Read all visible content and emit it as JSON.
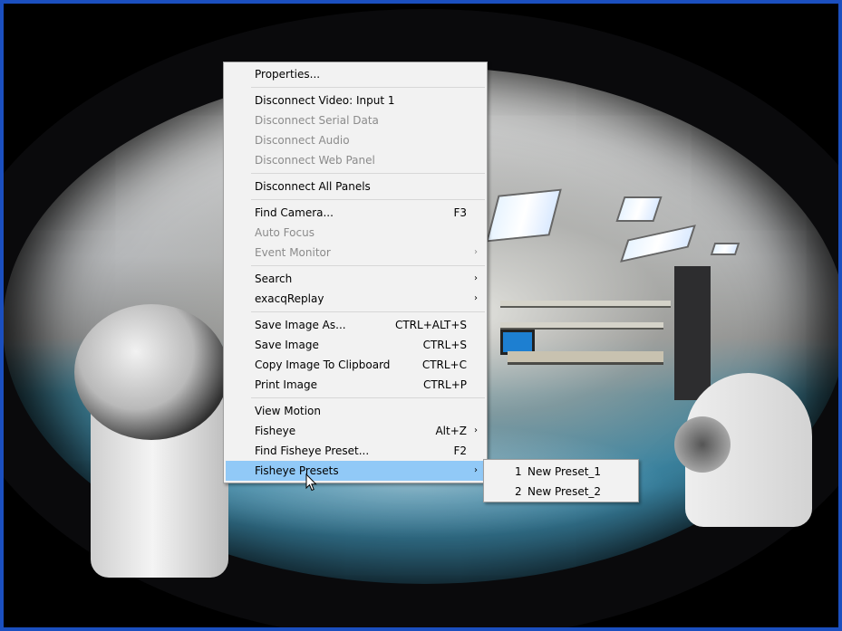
{
  "context_menu": {
    "items": [
      {
        "label": "Properties...",
        "shortcut": "",
        "arrow": "",
        "disabled": false
      },
      {
        "label": "Disconnect Video: Input 1",
        "shortcut": "",
        "arrow": "",
        "disabled": false
      },
      {
        "label": "Disconnect Serial Data",
        "shortcut": "",
        "arrow": "",
        "disabled": true
      },
      {
        "label": "Disconnect Audio",
        "shortcut": "",
        "arrow": "",
        "disabled": true
      },
      {
        "label": "Disconnect Web Panel",
        "shortcut": "",
        "arrow": "",
        "disabled": true
      },
      {
        "label": "Disconnect All Panels",
        "shortcut": "",
        "arrow": "",
        "disabled": false
      },
      {
        "label": "Find Camera...",
        "shortcut": "F3",
        "arrow": "",
        "disabled": false
      },
      {
        "label": "Auto Focus",
        "shortcut": "",
        "arrow": "",
        "disabled": true
      },
      {
        "label": "Event Monitor",
        "shortcut": "",
        "arrow": "›",
        "disabled": true
      },
      {
        "label": "Search",
        "shortcut": "",
        "arrow": "›",
        "disabled": false
      },
      {
        "label": "exacqReplay",
        "shortcut": "",
        "arrow": "›",
        "disabled": false
      },
      {
        "label": "Save Image As...",
        "shortcut": "CTRL+ALT+S",
        "arrow": "",
        "disabled": false
      },
      {
        "label": "Save Image",
        "shortcut": "CTRL+S",
        "arrow": "",
        "disabled": false
      },
      {
        "label": "Copy Image To Clipboard",
        "shortcut": "CTRL+C",
        "arrow": "",
        "disabled": false
      },
      {
        "label": "Print Image",
        "shortcut": "CTRL+P",
        "arrow": "",
        "disabled": false
      },
      {
        "label": "View Motion",
        "shortcut": "",
        "arrow": "",
        "disabled": false
      },
      {
        "label": "Fisheye",
        "shortcut": "Alt+Z",
        "arrow": "›",
        "disabled": false
      },
      {
        "label": "Find Fisheye Preset...",
        "shortcut": "F2",
        "arrow": "",
        "disabled": false
      },
      {
        "label": "Fisheye Presets",
        "shortcut": "",
        "arrow": "›",
        "disabled": false,
        "highlighted": true
      }
    ]
  },
  "fisheye_presets_submenu": {
    "items": [
      {
        "number": "1",
        "label": "New Preset_1"
      },
      {
        "number": "2",
        "label": "New Preset_2"
      }
    ]
  },
  "colors": {
    "window_border": "#1b4fbf",
    "menu_background": "#f2f2f2",
    "highlight": "#91c9f7",
    "disabled_text": "#8b8b8b"
  }
}
